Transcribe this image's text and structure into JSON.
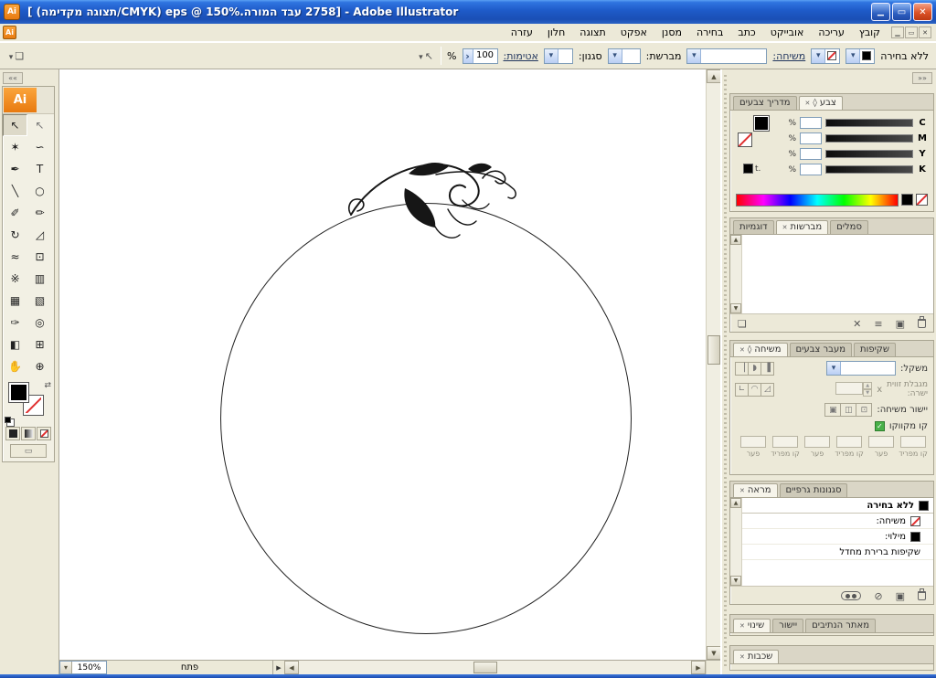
{
  "window": {
    "title": "Adobe Illustrator - [2758 עבד המורה.eps @ 150% (CMYK/תצוגה מקדימה) ]"
  },
  "menu": {
    "items": [
      "קובץ",
      "עריכה",
      "אובייקט",
      "כתב",
      "בחירה",
      "מסנן",
      "אפקט",
      "תצוגה",
      "חלון",
      "עזרה"
    ]
  },
  "control_bar": {
    "no_selection_label": "ללא בחירה",
    "stroke_link": "משיחה:",
    "brush_label": "מברשת:",
    "style_label": "סגנון:",
    "opacity_link": "אטימות:",
    "opacity_value": "100",
    "percent_label": "%"
  },
  "toolbox": {
    "logo": "Ai",
    "tools": [
      {
        "name": "selection",
        "glyph": "↖"
      },
      {
        "name": "direct-selection",
        "glyph": "↖"
      },
      {
        "name": "magic-wand",
        "glyph": "✶"
      },
      {
        "name": "lasso",
        "glyph": "∽"
      },
      {
        "name": "pen",
        "glyph": "✒"
      },
      {
        "name": "type",
        "glyph": "T"
      },
      {
        "name": "line-segment",
        "glyph": "╲"
      },
      {
        "name": "ellipse",
        "glyph": "○"
      },
      {
        "name": "paintbrush",
        "glyph": "✐"
      },
      {
        "name": "pencil",
        "glyph": "✏"
      },
      {
        "name": "rotate",
        "glyph": "↻"
      },
      {
        "name": "scale",
        "glyph": "◿"
      },
      {
        "name": "warp",
        "glyph": "≈"
      },
      {
        "name": "free-transform",
        "glyph": "⊡"
      },
      {
        "name": "symbol-sprayer",
        "glyph": "※"
      },
      {
        "name": "column-graph",
        "glyph": "▥"
      },
      {
        "name": "mesh",
        "glyph": "▦"
      },
      {
        "name": "gradient",
        "glyph": "▧"
      },
      {
        "name": "eyedropper",
        "glyph": "✑"
      },
      {
        "name": "blend",
        "glyph": "◎"
      },
      {
        "name": "live-paint-bucket",
        "glyph": "◧"
      },
      {
        "name": "live-paint-selection",
        "glyph": "⊞"
      },
      {
        "name": "hand",
        "glyph": "✋"
      },
      {
        "name": "zoom",
        "glyph": "⊕"
      }
    ]
  },
  "canvas": {
    "zoom_value": "150%",
    "status_text": "פתח"
  },
  "panels": {
    "color": {
      "tab": "צבע",
      "tab_guide": "מדריך צבעים",
      "channels": [
        "C",
        "M",
        "Y",
        "K"
      ],
      "percent": "%",
      "t_label": "t."
    },
    "brushes": {
      "tab_swatches": "דוגמיות",
      "tab": "מברשות",
      "tab_symbols": "סמלים"
    },
    "stroke": {
      "tab": "משיחה",
      "tab_gradient": "מעבר צבעים",
      "tab_transparency": "שקיפות",
      "weight_label": "משקל:",
      "miter_label_1": "מגבלת זווית",
      "miter_label_2": "ישרה:",
      "multiplier": "x",
      "align_label": "יישור משיחה:",
      "dashed_label": "קו מקווקו",
      "dash_labels": [
        "קו מפריד",
        "פער",
        "קו מפריד",
        "פער",
        "קו מפריד",
        "פער"
      ]
    },
    "appearance": {
      "tab": "מראה",
      "tab_styles": "סגנונות גרפיים",
      "rows": [
        "ללא בחירה",
        "משיחה:",
        "מילוי:",
        "שקיפות ברירת מחדל"
      ]
    },
    "groups": {
      "transform": "שינוי",
      "align": "יישור",
      "pathfinder": "מאתר הנתיבים",
      "layers": "שכבות"
    }
  }
}
